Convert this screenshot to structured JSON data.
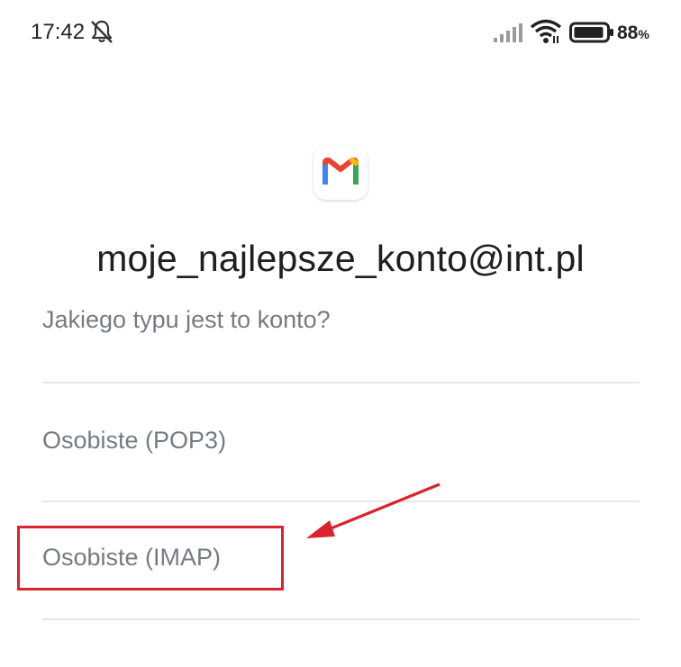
{
  "status_bar": {
    "time": "17:42",
    "battery_level": "88",
    "battery_unit": "%",
    "icons": [
      "bell-off-icon",
      "signal-icon",
      "wifi-icon",
      "battery-icon"
    ]
  },
  "app": {
    "logo_icon": "gmail-logo",
    "account_email": "moje_najlepsze_konto@int.pl",
    "question": "Jakiego typu jest to konto?"
  },
  "options": [
    {
      "label": "Osobiste (POP3)"
    },
    {
      "label": "Osobiste (IMAP)"
    }
  ],
  "annotation": {
    "highlight_color": "#d9232d",
    "highlighted_option": "Osobiste (IMAP)"
  }
}
